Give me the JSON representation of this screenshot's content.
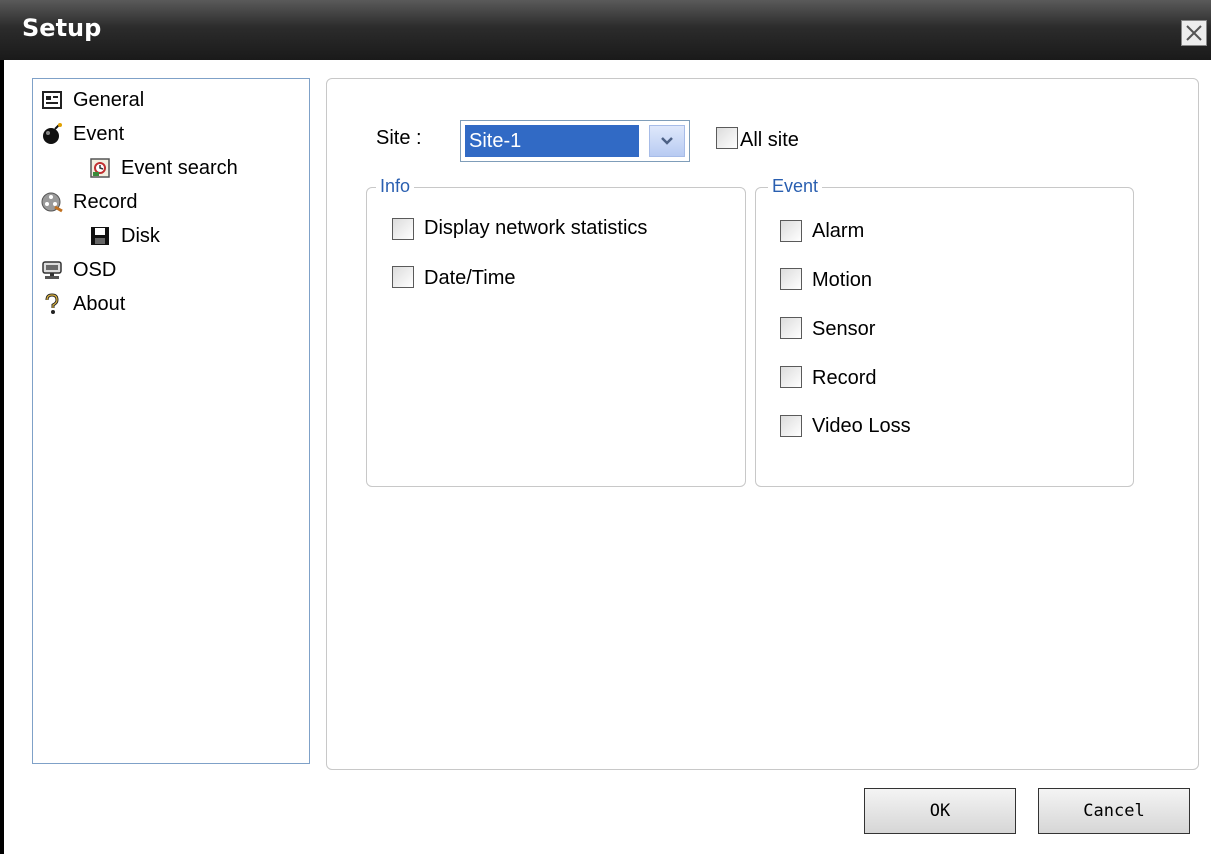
{
  "window": {
    "title": "Setup"
  },
  "nav": {
    "items": [
      {
        "label": "General",
        "icon": "general-icon"
      },
      {
        "label": "Event",
        "icon": "bomb-icon"
      },
      {
        "label": "Event search",
        "icon": "event-search-icon"
      },
      {
        "label": "Record",
        "icon": "film-reel-icon"
      },
      {
        "label": "Disk",
        "icon": "floppy-disk-icon"
      },
      {
        "label": "OSD",
        "icon": "monitor-icon"
      },
      {
        "label": "About",
        "icon": "question-icon"
      }
    ]
  },
  "site": {
    "label": "Site :",
    "selected": "Site-1",
    "all_site_label": "All site",
    "all_site_checked": false
  },
  "info": {
    "legend": "Info",
    "options": [
      {
        "label": "Display network statistics",
        "checked": false
      },
      {
        "label": "Date/Time",
        "checked": false
      }
    ]
  },
  "event": {
    "legend": "Event",
    "options": [
      {
        "label": "Alarm",
        "checked": false
      },
      {
        "label": "Motion",
        "checked": false
      },
      {
        "label": "Sensor",
        "checked": false
      },
      {
        "label": "Record",
        "checked": false
      },
      {
        "label": "Video Loss",
        "checked": false
      }
    ]
  },
  "buttons": {
    "ok": "OK",
    "cancel": "Cancel"
  },
  "colors": {
    "selection": "#316ac5",
    "legend_text": "#2a5fb0",
    "titlebar": "#2c2c2c"
  }
}
